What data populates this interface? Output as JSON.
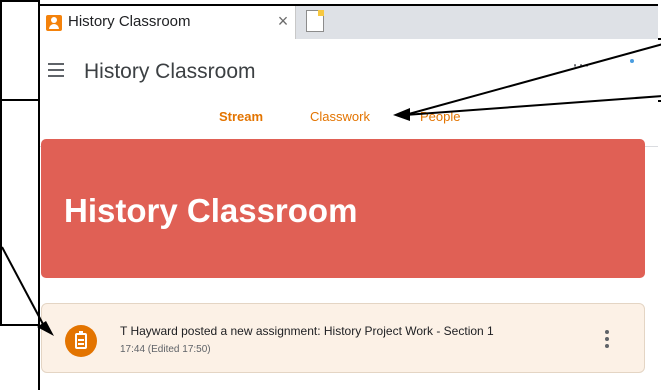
{
  "browser": {
    "tab_title": "History Classroom",
    "tab_close": "×"
  },
  "header": {
    "title": "History Classroom",
    "apps_icon": "⋯"
  },
  "nav": {
    "tabs": [
      {
        "label": "Stream",
        "active": true
      },
      {
        "label": "Classwork",
        "active": false
      },
      {
        "label": "People",
        "active": false
      }
    ],
    "accent_color": "#e37400"
  },
  "banner": {
    "title": "History Classroom",
    "color": "#e06055"
  },
  "post": {
    "text": "T Hayward posted a new assignment: History Project Work - Section 1",
    "time": "17:44 (Edited 17:50)",
    "icon": "assignment-icon",
    "background": "#fcf1e6"
  }
}
